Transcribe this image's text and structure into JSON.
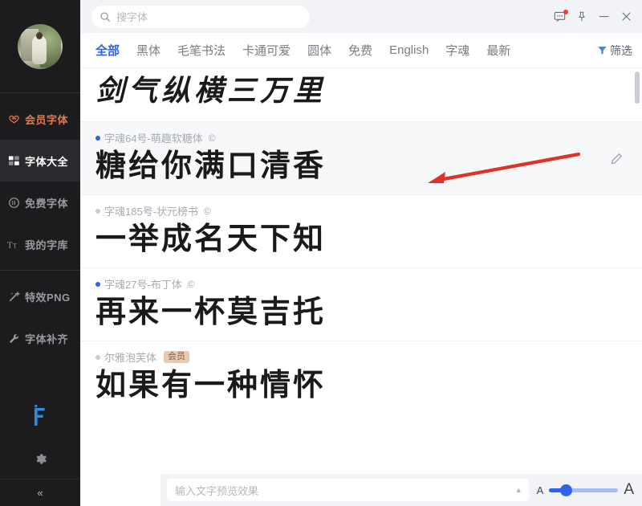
{
  "sidebar": {
    "avatar_alt": "user-avatar",
    "items": [
      {
        "label": "会员字体",
        "icon": "crown-icon",
        "state": "vip"
      },
      {
        "label": "字体大全",
        "icon": "grid-icon",
        "state": "active"
      },
      {
        "label": "免费字体",
        "icon": "free-icon",
        "state": "normal"
      },
      {
        "label": "我的字库",
        "icon": "typography-icon",
        "state": "normal"
      },
      {
        "label": "特效PNG",
        "icon": "magic-wand-icon",
        "state": "normal"
      },
      {
        "label": "字体补齐",
        "icon": "wrench-icon",
        "state": "normal"
      }
    ],
    "logo": "app-logo",
    "settings_icon": "gear-icon",
    "collapse_label": "«"
  },
  "topbar": {
    "search_placeholder": "搜字体",
    "search_value": "",
    "icons": {
      "search": "search-icon",
      "feedback": "message-icon",
      "pin": "pin-icon",
      "minimize": "minimize-icon",
      "close": "close-icon"
    },
    "notification_dot": true
  },
  "tabs": {
    "items": [
      {
        "label": "全部",
        "active": true
      },
      {
        "label": "黑体",
        "active": false
      },
      {
        "label": "毛笔书法",
        "active": false
      },
      {
        "label": "卡通可爱",
        "active": false
      },
      {
        "label": "圆体",
        "active": false
      },
      {
        "label": "免费",
        "active": false
      },
      {
        "label": "English",
        "active": false
      },
      {
        "label": "字魂",
        "active": false
      },
      {
        "label": "最新",
        "active": false
      }
    ],
    "filter_label": "筛选",
    "filter_icon": "funnel-icon"
  },
  "fonts": [
    {
      "name": "",
      "copyright": "",
      "sample": "剑气纵横三万里",
      "dot_color": "",
      "badge": "",
      "hovered": false,
      "style": "brush"
    },
    {
      "name": "字魂64号-萌趣软糖体",
      "copyright": "©",
      "sample": "糖给你满口清香",
      "dot_color": "#2f63e8",
      "badge": "",
      "hovered": true,
      "style": "rounded"
    },
    {
      "name": "字魂185号-状元榜书",
      "copyright": "©",
      "sample": "一举成名天下知",
      "dot_color": "#c9ccd4",
      "badge": "",
      "hovered": false,
      "style": "bold"
    },
    {
      "name": "字魂27号-布丁体",
      "copyright": "©",
      "sample": "再来一杯莫吉托",
      "dot_color": "#2f63e8",
      "badge": "",
      "hovered": false,
      "style": "bold"
    },
    {
      "name": "尔雅泡芙体",
      "copyright": "",
      "sample": "如果有一种情怀",
      "dot_color": "#c9ccd4",
      "badge": "会员",
      "hovered": false,
      "style": "bold"
    }
  ],
  "edit_icon": "pencil-icon",
  "bottombar": {
    "preview_placeholder": "输入文字预览效果",
    "preview_value": "",
    "expand_icon": "caret-up-icon",
    "size_small_label": "A",
    "size_large_label": "A",
    "slider_value": 20
  },
  "annotation": {
    "arrow_color": "#e03127",
    "type": "arrow-pointing-left"
  },
  "colors": {
    "accent": "#2f63e8",
    "vip": "#e07a4c",
    "sidebar_bg": "#1c1c1e",
    "chrome_bg": "#f2f3f7",
    "badge_bg": "#e6cbb2"
  }
}
